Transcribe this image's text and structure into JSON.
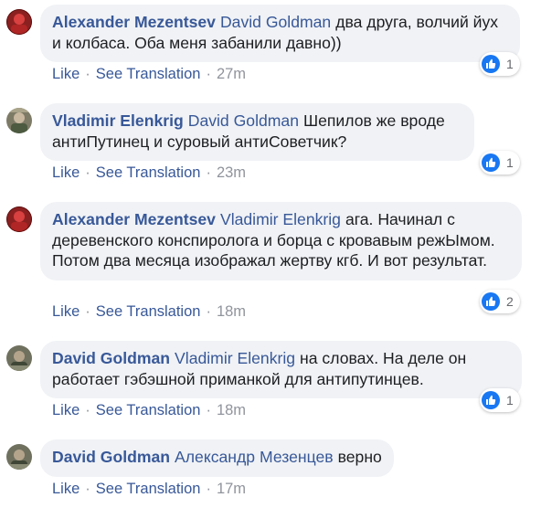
{
  "actions": {
    "like": "Like",
    "see_translation": "See Translation",
    "separator": "·"
  },
  "colors": {
    "link": "#385898",
    "bubble_bg": "#f0f2f5",
    "like_badge": "#1877f2",
    "meta_text": "#90949c"
  },
  "comments": [
    {
      "author": "Alexander Mezentsev",
      "mention": "David Goldman",
      "text": "два друга, волчий йух и колбаса. Оба меня забанили давно))",
      "time": "27m",
      "reaction_icon": "thumbs-up-icon",
      "reactions": "1"
    },
    {
      "author": "Vladimir Elenkrig",
      "mention": "David Goldman",
      "text": "Шепилов же вроде антиПутинец и суровый антиСоветчик?",
      "time": "23m",
      "reaction_icon": "thumbs-up-icon",
      "reactions": "1"
    },
    {
      "author": "Alexander Mezentsev",
      "mention": "Vladimir Elenkrig",
      "text": "ага. Начинал с деревенского конспиролога и борца с кровавым режЫмом. Потом два месяца изображал жертву кгб. И вот результат.",
      "time": "18m",
      "reaction_icon": "thumbs-up-icon",
      "reactions": "2"
    },
    {
      "author": "David Goldman",
      "mention": "Vladimir Elenkrig",
      "text": "на словах. На деле он работает гэбэшной приманкой для антипутинцев.",
      "time": "18m",
      "reaction_icon": "thumbs-up-icon",
      "reactions": "1"
    },
    {
      "author": "David Goldman",
      "mention": "Александр Мезенцев",
      "text": "верно",
      "time": "17m"
    }
  ]
}
